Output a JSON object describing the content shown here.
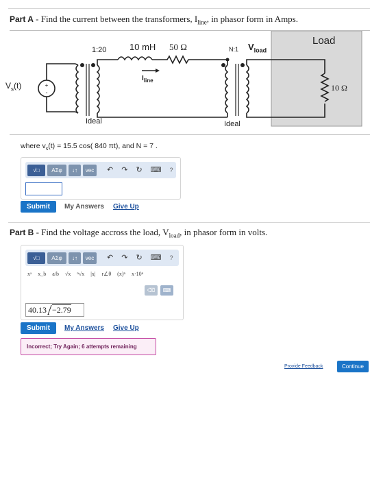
{
  "partA": {
    "label": "Part A",
    "question": " - Find the current between the transformers, I",
    "question_sub": "line",
    "question_end": ", in phasor form in Amps."
  },
  "circuit": {
    "load_title": "Load",
    "ratio_left": "1:20",
    "inductor_label": "10 mH",
    "resistor_label": "50 Ω",
    "ratio_right": "N:1",
    "vload_label": "V",
    "vload_sub": "load",
    "iline_label": "I",
    "iline_sub": "line",
    "vs_label": "V",
    "vs_sub": "s",
    "vs_paren": "(t)",
    "ideal_left": "Ideal",
    "ideal_right": "Ideal",
    "load_resistor": "10 Ω"
  },
  "where": {
    "prefix": "where v",
    "sub": "s",
    "rest": "(t) = 15.5 cos( 840 πt), and N = 7 ."
  },
  "toolbar": {
    "templates_label": "√□",
    "greek_label": "ΑΣφ",
    "arrows_label": "↓↑",
    "vec_label": "vec",
    "undo": "↶",
    "redo": "↷",
    "reset": "↻",
    "keyboard": "⌨",
    "help": "?"
  },
  "partA_actions": {
    "submit": "Submit",
    "my_answers": "My Answers",
    "give_up": "Give Up"
  },
  "partB": {
    "label": "Part B",
    "question": " - Find the voltage accross the load, V",
    "question_sub": "load",
    "question_end": ", in phasor form in volts."
  },
  "partB_templates": [
    "xᵃ",
    "x_b",
    "a/b",
    "√x",
    "ⁿ√x",
    "|x|",
    "r∠θ",
    "(x)ⁿ",
    "x·10ⁿ"
  ],
  "partB_answer": {
    "magnitude": "40.13",
    "angle": "−2.79"
  },
  "partB_actions": {
    "submit": "Submit",
    "my_answers": "My Answers",
    "give_up": "Give Up"
  },
  "feedback": "Incorrect; Try Again; 6 attempts remaining",
  "footer": {
    "provide_feedback": "Provide Feedback",
    "continue": "Continue"
  },
  "colors": {
    "accent": "#1a74c7",
    "toolbar_bg": "#dfe8f4",
    "load_bg": "#d9d9d9",
    "error_border": "#c44aa3"
  }
}
